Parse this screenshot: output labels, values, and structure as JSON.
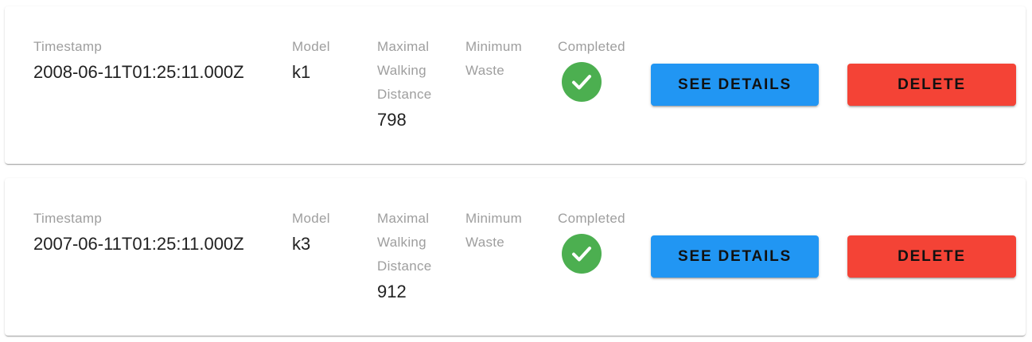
{
  "labels": {
    "timestamp": "Timestamp",
    "model": "Model",
    "max_walk_line1": "Maximal",
    "max_walk_line2": "Walking",
    "max_walk_line3": "Distance",
    "min_waste_line1": "Minimum",
    "min_waste_line2": "Waste",
    "completed": "Completed",
    "see_details": "SEE DETAILS",
    "delete": "DELETE"
  },
  "colors": {
    "details_button": "#2196f3",
    "delete_button": "#f44336",
    "completed_icon": "#4caf50"
  },
  "records": [
    {
      "timestamp": "2008-06-11T01:25:11.000Z",
      "model": "k1",
      "maximal_walking_distance": "798",
      "minimum_waste": "",
      "completed": true,
      "completed_icon": "check-circle-icon"
    },
    {
      "timestamp": "2007-06-11T01:25:11.000Z",
      "model": "k3",
      "maximal_walking_distance": "912",
      "minimum_waste": "",
      "completed": true,
      "completed_icon": "check-circle-icon"
    }
  ]
}
